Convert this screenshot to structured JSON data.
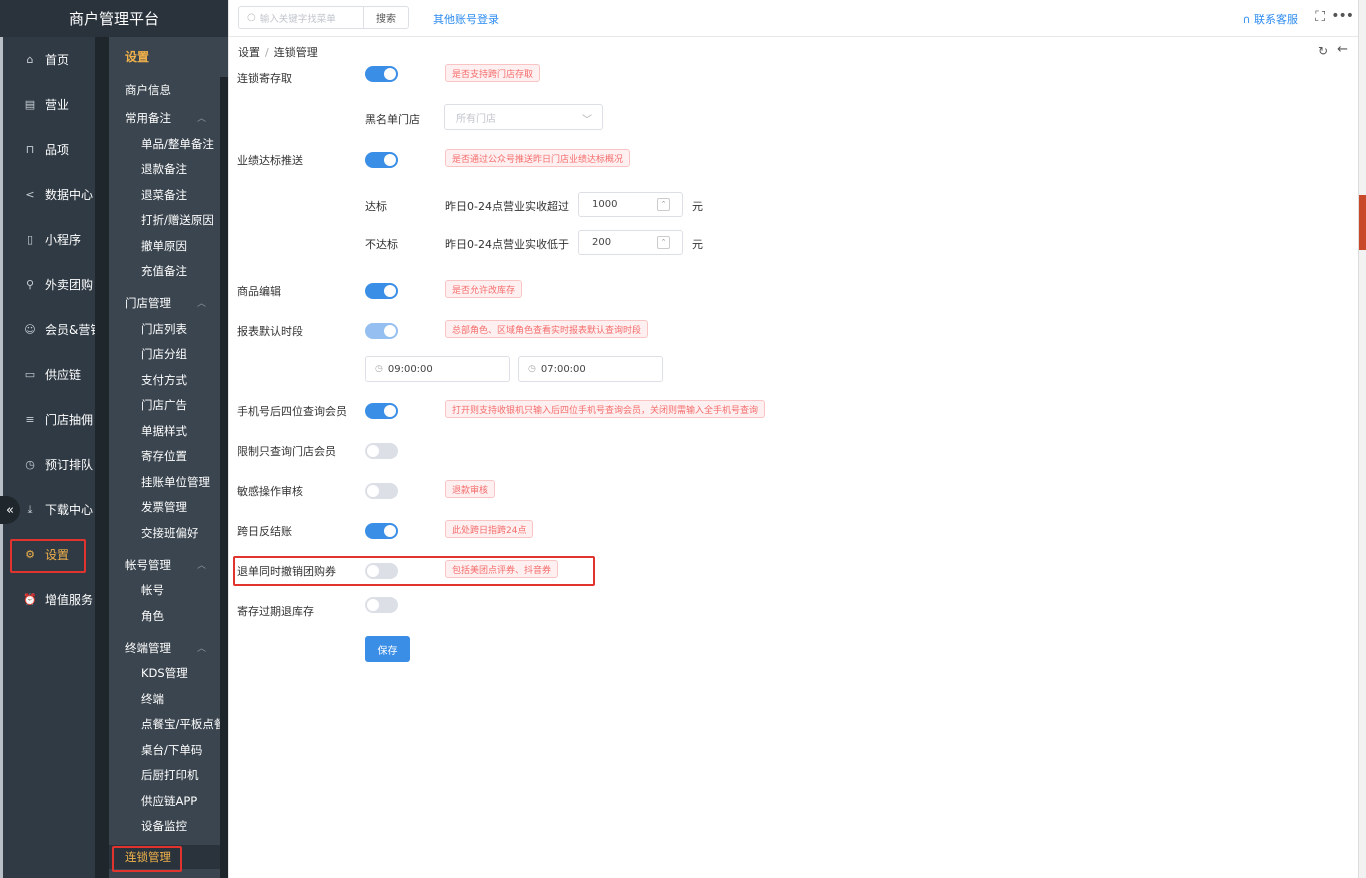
{
  "brand": "商户管理平台",
  "main_menu": [
    {
      "label": "首页",
      "icon": "home-icon",
      "glyph": "⌂"
    },
    {
      "label": "营业",
      "icon": "calendar-icon",
      "glyph": "▤"
    },
    {
      "label": "品项",
      "icon": "bag-icon",
      "glyph": "⊓"
    },
    {
      "label": "数据中心",
      "icon": "share-icon",
      "glyph": "<"
    },
    {
      "label": "小程序",
      "icon": "mobile-icon",
      "glyph": "▯"
    },
    {
      "label": "外卖团购",
      "icon": "bike-icon",
      "glyph": "⚲"
    },
    {
      "label": "会员&营销",
      "icon": "user-icon",
      "glyph": "☺"
    },
    {
      "label": "供应链",
      "icon": "truck-icon",
      "glyph": "▭"
    },
    {
      "label": "门店抽佣",
      "icon": "database-icon",
      "glyph": "≡"
    },
    {
      "label": "预订排队",
      "icon": "clock-icon",
      "glyph": "◷"
    },
    {
      "label": "下载中心",
      "icon": "download-icon",
      "glyph": "⤓"
    },
    {
      "label": "设置",
      "icon": "gear-icon",
      "glyph": "⚙"
    },
    {
      "label": "增值服务",
      "icon": "alarm-icon",
      "glyph": "⏰"
    }
  ],
  "sub_menu": {
    "title": "设置",
    "merchant_info": "商户信息",
    "groups": [
      {
        "label": "常用备注",
        "items": [
          "单品/整单备注",
          "退款备注",
          "退菜备注",
          "打折/赠送原因",
          "撤单原因",
          "充值备注"
        ]
      },
      {
        "label": "门店管理",
        "items": [
          "门店列表",
          "门店分组",
          "支付方式",
          "门店广告",
          "单据样式",
          "寄存位置",
          "挂账单位管理",
          "发票管理",
          "交接班偏好"
        ]
      },
      {
        "label": "帐号管理",
        "items": [
          "帐号",
          "角色"
        ]
      },
      {
        "label": "终端管理",
        "items": [
          "KDS管理",
          "终端",
          "点餐宝/平板点餐",
          "桌台/下单码",
          "后厨打印机",
          "供应链APP",
          "设备监控"
        ]
      }
    ],
    "active": "连锁管理"
  },
  "topbar": {
    "search_placeholder": "输入关键字找菜单",
    "search_button": "搜索",
    "other_login": "其他账号登录",
    "contact": "联系客服"
  },
  "breadcrumb": {
    "root": "设置",
    "current": "连锁管理"
  },
  "settings": {
    "chain_deposit": {
      "label": "连锁寄存取",
      "on": true,
      "tag": "是否支持跨门店存取"
    },
    "blacklist": {
      "label": "黑名单门店",
      "placeholder": "所有门店"
    },
    "target_push": {
      "label": "业绩达标推送",
      "on": true,
      "tag": "是否通过公众号推送昨日门店业绩达标概况"
    },
    "reach": {
      "label": "达标",
      "desc": "昨日0-24点营业实收超过",
      "value": "1000",
      "unit": "元"
    },
    "not_reach": {
      "label": "不达标",
      "desc": "昨日0-24点营业实收低于",
      "value": "200",
      "unit": "元"
    },
    "goods_edit": {
      "label": "商品编辑",
      "on": true,
      "tag": "是否允许改库存"
    },
    "report_period": {
      "label": "报表默认时段",
      "on": true,
      "tag": "总部角色、区域角色查看实时报表默认查询时段",
      "start": "09:00:00",
      "end": "07:00:00"
    },
    "phone_last4": {
      "label": "手机号后四位查询会员",
      "on": true,
      "tag": "打开则支持收银机只输入后四位手机号查询会员，关闭则需输入全手机号查询"
    },
    "limit_store_member": {
      "label": "限制只查询门店会员",
      "on": false
    },
    "sensitive_audit": {
      "label": "敏感操作审核",
      "on": false,
      "tag": "退款审核"
    },
    "cross_day": {
      "label": "跨日反结账",
      "on": true,
      "tag": "此处跨日指跨24点"
    },
    "refund_coupon": {
      "label": "退单同时撤销团购券",
      "on": false,
      "tag": "包括美团点评券、抖音券"
    },
    "deposit_expire": {
      "label": "寄存过期退库存",
      "on": false
    }
  },
  "save_label": "保存",
  "colors": {
    "accent": "#3a8ee6",
    "sidebar": "#2f3a44",
    "active_text": "#f2b24a",
    "highlight": "#e2342f"
  }
}
